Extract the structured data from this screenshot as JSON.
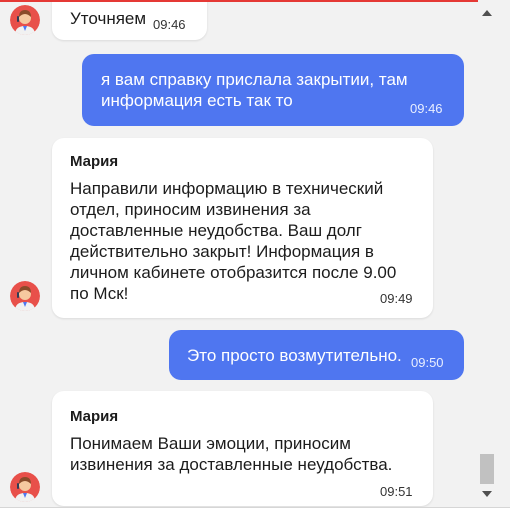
{
  "colors": {
    "accent_top": "#e53935",
    "outgoing_bubble": "#4f76f0",
    "incoming_bubble": "#ffffff",
    "background": "#f2f2f2"
  },
  "messages": [
    {
      "direction": "incoming",
      "sender": "",
      "text": "Уточняем",
      "time": "09:46"
    },
    {
      "direction": "outgoing",
      "sender": "",
      "text": "я вам справку прислала закрытии, там информация есть так то",
      "time": "09:46"
    },
    {
      "direction": "incoming",
      "sender": "Мария",
      "text": "Направили информацию в технический отдел, приносим извинения за доставленные неудобства. Ваш долг действительно закрыт! Информация в личном кабинете отобразится после 9.00 по Мск!",
      "time": "09:49"
    },
    {
      "direction": "outgoing",
      "sender": "",
      "text": "Это просто возмутительно.",
      "time": "09:50"
    },
    {
      "direction": "incoming",
      "sender": "Мария",
      "text": "Понимаем Ваши эмоции, приносим извинения за доставленные неудобства.",
      "time": "09:51"
    }
  ],
  "icons": {
    "avatar": "operator-avatar-icon",
    "scroll_up": "chevron-up-icon",
    "scroll_down": "chevron-down-icon"
  }
}
